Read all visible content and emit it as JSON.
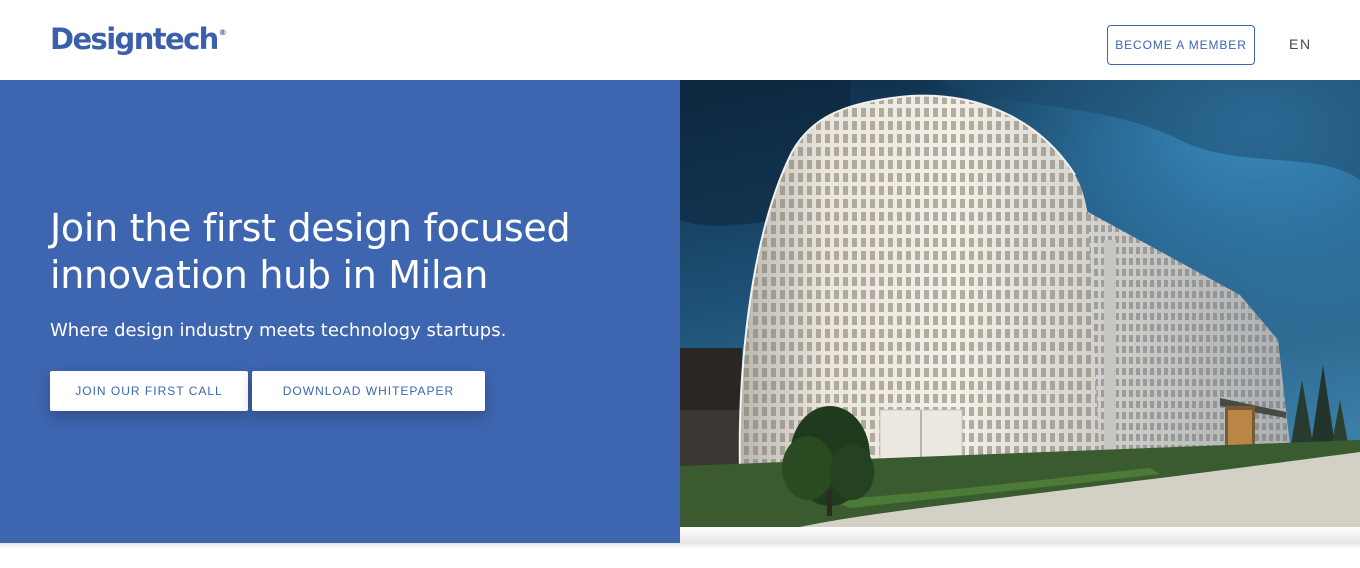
{
  "header": {
    "logo_text": "Designtech",
    "logo_mark": "®",
    "member_button": "BECOME A MEMBER",
    "language": "EN"
  },
  "hero": {
    "title": "Join the first design focused innovation hub in Milan",
    "subtitle": "Where design industry meets technology startups.",
    "primary_button": "JOIN OUR FIRST CALL",
    "secondary_button": "DOWNLOAD WHITEPAPER"
  },
  "colors": {
    "brand_blue": "#3e65b0",
    "button_text": "#3a66b4",
    "white": "#ffffff"
  }
}
